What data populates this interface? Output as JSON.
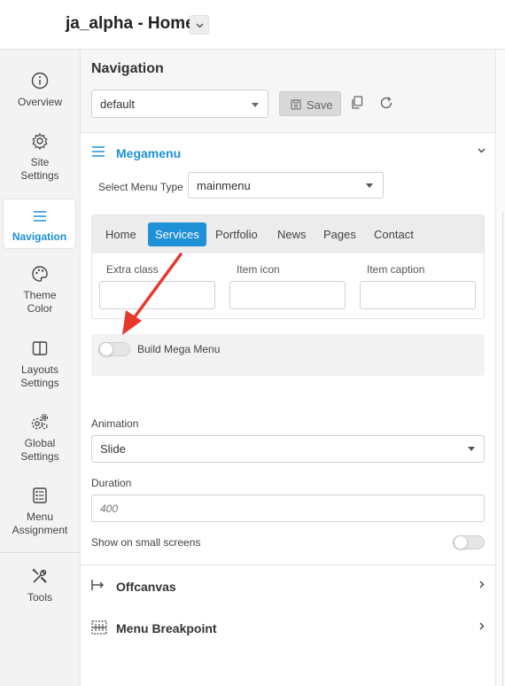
{
  "app": {
    "title": "ja_alpha - Home"
  },
  "sidebar": {
    "items": [
      {
        "label1": "Overview",
        "label2": ""
      },
      {
        "label1": "Site",
        "label2": "Settings"
      },
      {
        "label1": "Navigation",
        "label2": ""
      },
      {
        "label1": "Theme",
        "label2": "Color"
      },
      {
        "label1": "Layouts",
        "label2": "Settings"
      },
      {
        "label1": "Global",
        "label2": "Settings"
      },
      {
        "label1": "Menu",
        "label2": "Assignment"
      },
      {
        "label1": "Tools",
        "label2": ""
      }
    ]
  },
  "panel": {
    "title": "Navigation",
    "preset_value": "default",
    "save_label": "Save"
  },
  "megamenu": {
    "title": "Megamenu",
    "menu_type_label": "Select Menu Type",
    "menu_type_value": "mainmenu",
    "tabs": [
      "Home",
      "Services",
      "Portfolio",
      "News",
      "Pages",
      "Contact"
    ],
    "active_tab": "Services",
    "extra_class_label": "Extra class",
    "item_icon_label": "Item icon",
    "item_caption_label": "Item caption",
    "build_label": "Build Mega Menu",
    "build_enabled": false,
    "animation_label": "Animation",
    "animation_value": "Slide",
    "duration_label": "Duration",
    "duration_placeholder": "400",
    "small_screens_label": "Show on small screens",
    "small_screens_enabled": false
  },
  "sections": {
    "offcanvas": "Offcanvas",
    "breakpoint": "Menu Breakpoint"
  },
  "colors": {
    "accent": "#1e90d6",
    "arrow": "#e8382b"
  }
}
